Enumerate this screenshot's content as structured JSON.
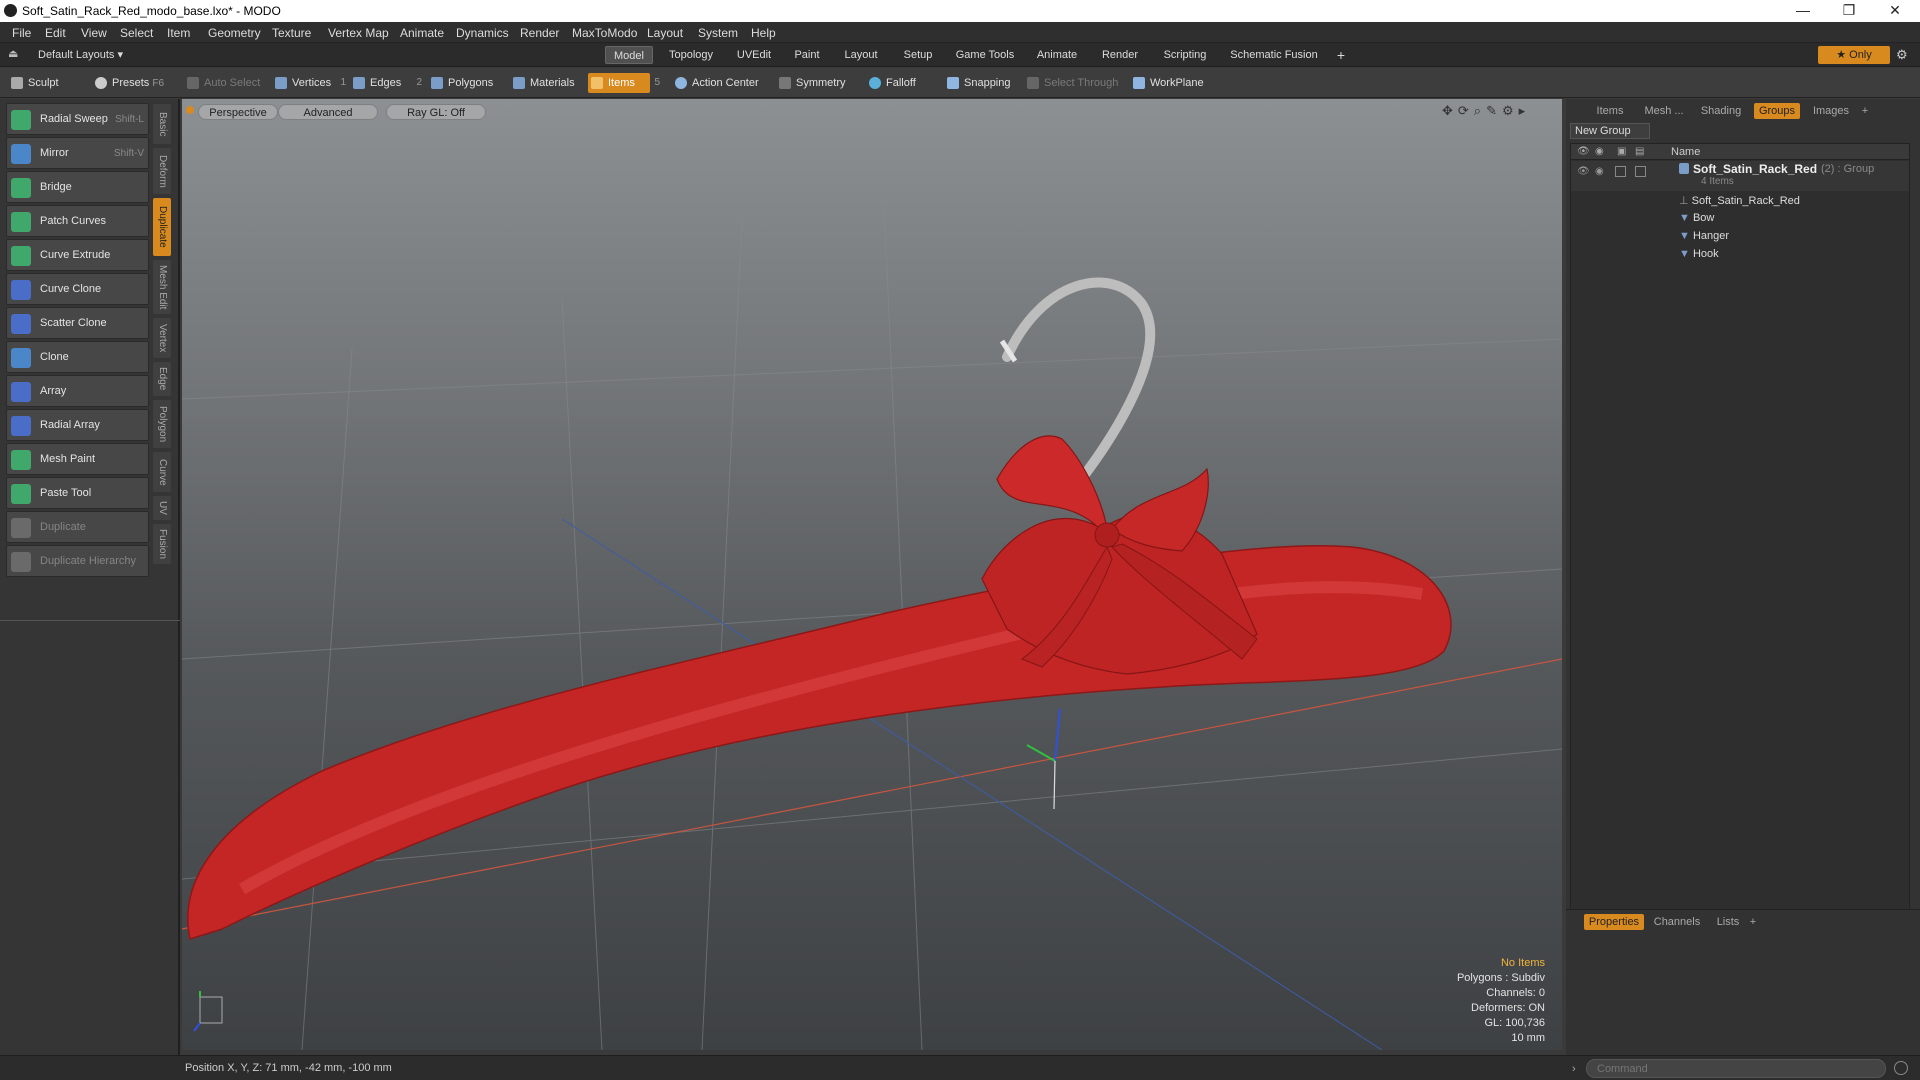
{
  "window": {
    "title": "Soft_Satin_Rack_Red_modo_base.lxo* - MODO",
    "minimize": "—",
    "restore": "❐",
    "close": "✕"
  },
  "menu": [
    "File",
    "Edit",
    "View",
    "Select",
    "Item",
    "Geometry",
    "Texture",
    "Vertex Map",
    "Animate",
    "Dynamics",
    "Render",
    "MaxToModo",
    "Layout",
    "System",
    "Help"
  ],
  "layoutbar": {
    "layouts": "Default Layouts ▾",
    "tabs": [
      "Model",
      "Topology",
      "UVEdit",
      "Paint",
      "Layout",
      "Setup",
      "Game Tools",
      "Animate",
      "Render",
      "Scripting",
      "Schematic Fusion"
    ],
    "active_tab": "Model",
    "add": "+",
    "only": "★ Only"
  },
  "toolbar": {
    "sculpt": "Sculpt",
    "presets": "Presets",
    "presets_key": "F6",
    "auto_select": "Auto Select",
    "vertices": "Vertices",
    "vertices_count": "1",
    "edges": "Edges",
    "edges_count": "2",
    "polygons": "Polygons",
    "materials": "Materials",
    "items": "Items",
    "items_count": "5",
    "action_center": "Action Center",
    "symmetry": "Symmetry",
    "falloff": "Falloff",
    "snapping": "Snapping",
    "select_through": "Select Through",
    "workplane": "WorkPlane"
  },
  "tools": [
    {
      "label": "Radial Sweep",
      "shortcut": "Shift-L",
      "color": "#3fa86a",
      "disabled": false
    },
    {
      "label": "Mirror",
      "shortcut": "Shift-V",
      "color": "#4a86c8",
      "disabled": false
    },
    {
      "label": "Bridge",
      "shortcut": "",
      "color": "#3fa86a",
      "disabled": false
    },
    {
      "label": "Patch Curves",
      "shortcut": "",
      "color": "#3fa86a",
      "disabled": false
    },
    {
      "label": "Curve Extrude",
      "shortcut": "",
      "color": "#3fa86a",
      "disabled": false
    },
    {
      "label": "Curve Clone",
      "shortcut": "",
      "color": "#4a6ec8",
      "disabled": false
    },
    {
      "label": "Scatter Clone",
      "shortcut": "",
      "color": "#4a6ec8",
      "disabled": false
    },
    {
      "label": "Clone",
      "shortcut": "",
      "color": "#4a86c8",
      "disabled": false
    },
    {
      "label": "Array",
      "shortcut": "",
      "color": "#4a6ec8",
      "disabled": false
    },
    {
      "label": "Radial Array",
      "shortcut": "",
      "color": "#4a6ec8",
      "disabled": false
    },
    {
      "label": "Mesh Paint",
      "shortcut": "",
      "color": "#3fa86a",
      "disabled": false
    },
    {
      "label": "Paste Tool",
      "shortcut": "",
      "color": "#3fa86a",
      "disabled": false
    },
    {
      "label": "Duplicate",
      "shortcut": "",
      "color": "#777",
      "disabled": true
    },
    {
      "label": "Duplicate Hierarchy",
      "shortcut": "",
      "color": "#777",
      "disabled": true
    }
  ],
  "vtabs": [
    "Basic",
    "Deform",
    "Duplicate",
    "Mesh Edit",
    "Vertex",
    "Edge",
    "Polygon",
    "Curve",
    "UV",
    "Fusion"
  ],
  "active_vtab": "Duplicate",
  "viewport": {
    "view": "Perspective",
    "mode": "Advanced",
    "raygl": "Ray GL: Off"
  },
  "stats": {
    "no_items": "No Items",
    "polygons": "Polygons : Subdiv",
    "channels": "Channels: 0",
    "deformers": "Deformers: ON",
    "gl": "GL: 100,736",
    "scale": "10 mm"
  },
  "right_tabs": [
    "Items",
    "Mesh ...",
    "Shading",
    "Groups",
    "Images"
  ],
  "active_right_tab": "Groups",
  "groups": {
    "new_group": "New Group",
    "name_header": "Name",
    "group_name": "Soft_Satin_Rack_Red",
    "group_suffix": "(2) : Group",
    "item_count": "4 Items",
    "children": [
      "Soft_Satin_Rack_Red",
      "Bow",
      "Hanger",
      "Hook"
    ]
  },
  "bottom_tabs": [
    "Properties",
    "Channels",
    "Lists"
  ],
  "active_bottom_tab": "Properties",
  "status": {
    "position": "Position X, Y, Z:  71 mm, -42 mm, -100 mm",
    "command_placeholder": "Command"
  },
  "colors": {
    "accent": "#d88a1e",
    "satin": "#c82a2a"
  }
}
